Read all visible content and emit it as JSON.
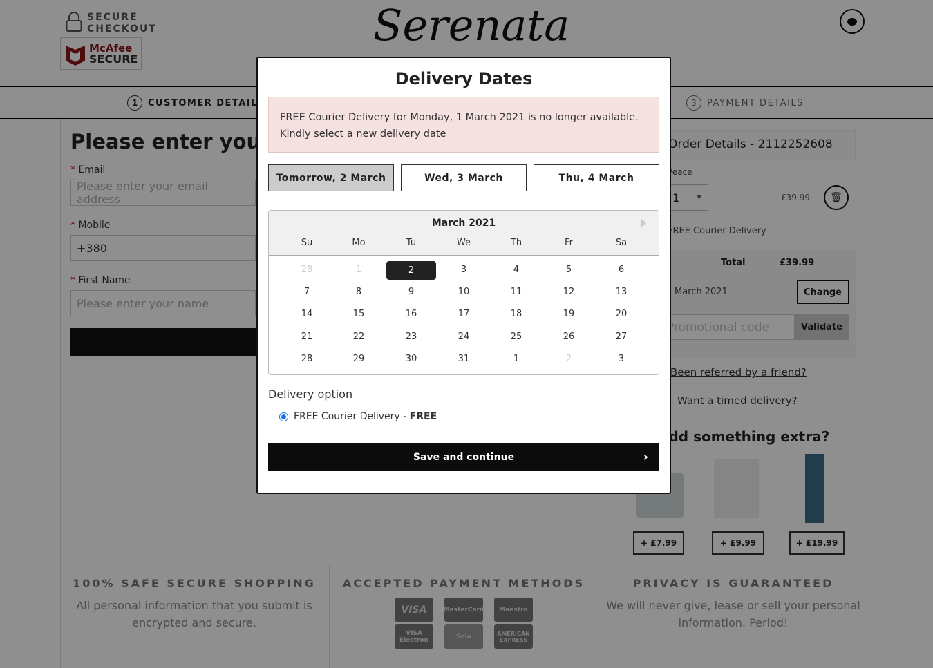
{
  "header": {
    "secure_line1": "SECURE",
    "secure_line2": "CHECKOUT",
    "mcafee_line1": "McAfee",
    "mcafee_line2": "SECURE",
    "logo": "Serenata"
  },
  "steps": [
    {
      "num": "1",
      "label": "CUSTOMER DETAILS"
    },
    {
      "num": "3",
      "label": "PAYMENT DETAILS"
    }
  ],
  "form": {
    "heading": "Please enter your",
    "email_label": "Email",
    "email_placeholder": "Please enter your email address",
    "mobile_label": "Mobile",
    "mobile_value": "+380",
    "first_name_label": "First Name",
    "first_name_placeholder": "Please enter your name",
    "required_mark": "*"
  },
  "order": {
    "title": "Order Details - 2112252608",
    "product": "Peace",
    "qty": "1",
    "price": "£39.99",
    "delivery": "FREE Courier Delivery",
    "total_label": "Total",
    "total_value": "£39.99",
    "date": "March 2021",
    "change": "Change",
    "promo_placeholder": "Promotional code",
    "validate": "Validate",
    "referred": "Been referred by a friend?",
    "timed": "Want a timed delivery?",
    "extra_title": "Add something extra?",
    "extras": [
      "+ £7.99",
      "+ £9.99",
      "+ £19.99"
    ]
  },
  "footer": [
    {
      "title": "100% SAFE SECURE SHOPPING",
      "text": "All personal information that you submit is encrypted and secure."
    },
    {
      "title": "ACCEPTED PAYMENT METHODS",
      "cards": [
        "VISA",
        "MasterCard",
        "Maestro",
        "VISA Electron",
        "Solo",
        "AMERICAN EXPRESS"
      ]
    },
    {
      "title": "PRIVACY IS GUARANTEED",
      "text": "We will never give, lease or sell your personal information. Period!"
    }
  ],
  "modal": {
    "title": "Delivery Dates",
    "alert_line1": "FREE Courier Delivery for Monday, 1 March 2021 is no longer available.",
    "alert_line2": "Kindly select a new delivery date",
    "quick_dates": [
      {
        "label": "Tomorrow, 2 March",
        "selected": true
      },
      {
        "label": "Wed, 3 March",
        "selected": false
      },
      {
        "label": "Thu, 4 March",
        "selected": false
      }
    ],
    "calendar": {
      "month": "March 2021",
      "weekdays": [
        "Su",
        "Mo",
        "Tu",
        "We",
        "Th",
        "Fr",
        "Sa"
      ],
      "weeks": [
        [
          {
            "d": "28",
            "m": true
          },
          {
            "d": "1",
            "m": true
          },
          {
            "d": "2",
            "s": true
          },
          {
            "d": "3"
          },
          {
            "d": "4"
          },
          {
            "d": "5"
          },
          {
            "d": "6"
          }
        ],
        [
          {
            "d": "7"
          },
          {
            "d": "8"
          },
          {
            "d": "9"
          },
          {
            "d": "10"
          },
          {
            "d": "11"
          },
          {
            "d": "12"
          },
          {
            "d": "13"
          }
        ],
        [
          {
            "d": "14"
          },
          {
            "d": "15"
          },
          {
            "d": "16"
          },
          {
            "d": "17"
          },
          {
            "d": "18"
          },
          {
            "d": "19"
          },
          {
            "d": "20"
          }
        ],
        [
          {
            "d": "21"
          },
          {
            "d": "22"
          },
          {
            "d": "23"
          },
          {
            "d": "24"
          },
          {
            "d": "25"
          },
          {
            "d": "26"
          },
          {
            "d": "27"
          }
        ],
        [
          {
            "d": "28"
          },
          {
            "d": "29"
          },
          {
            "d": "30"
          },
          {
            "d": "31"
          },
          {
            "d": "1"
          },
          {
            "d": "2",
            "m": true
          },
          {
            "d": "3"
          }
        ]
      ]
    },
    "delivery_option_label": "Delivery option",
    "option_text": "FREE Courier Delivery - ",
    "option_price": "FREE",
    "save": "Save and continue"
  },
  "colors": {
    "alert_bg": "#f5e1df",
    "selected": "#222222",
    "radio": "#1a73e8"
  }
}
